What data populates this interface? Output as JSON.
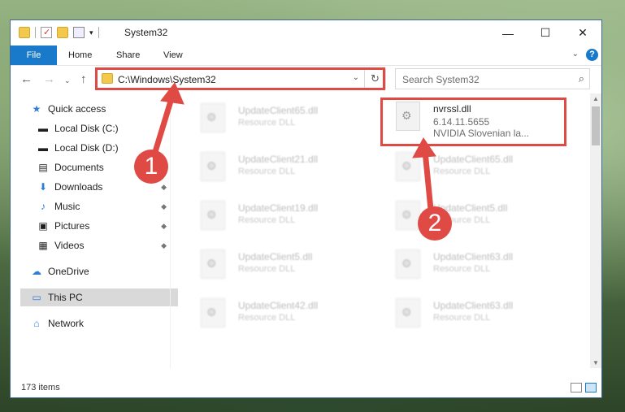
{
  "window": {
    "title": "System32"
  },
  "ribbon": {
    "tabs": [
      "File",
      "Home",
      "Share",
      "View"
    ],
    "help": "?"
  },
  "nav": {
    "address": "C:\\Windows\\System32",
    "search_placeholder": "Search System32"
  },
  "sidebar": {
    "items": [
      {
        "label": "Quick access",
        "icon": "star-icon"
      },
      {
        "label": "Local Disk (C:)",
        "icon": "drive-icon"
      },
      {
        "label": "Local Disk (D:)",
        "icon": "drive-icon"
      },
      {
        "label": "Documents",
        "icon": "documents-icon"
      },
      {
        "label": "Downloads",
        "icon": "download-icon"
      },
      {
        "label": "Music",
        "icon": "music-icon"
      },
      {
        "label": "Pictures",
        "icon": "pictures-icon"
      },
      {
        "label": "Videos",
        "icon": "videos-icon"
      },
      {
        "label": "OneDrive",
        "icon": "cloud-icon"
      },
      {
        "label": "This PC",
        "icon": "computer-icon"
      },
      {
        "label": "Network",
        "icon": "network-icon"
      }
    ]
  },
  "files": [
    {
      "name": "UpdateClient65.dll",
      "type": "Resource DLL"
    },
    {
      "name": "nvrssl.dll",
      "version": "6.14.11.5655",
      "desc": "NVIDIA Slovenian la..."
    },
    {
      "name": "UpdateClient21.dll",
      "type": "Resource DLL"
    },
    {
      "name": "UpdateClient65.dll",
      "type": "Resource DLL"
    },
    {
      "name": "UpdateClient19.dll",
      "type": "Resource DLL"
    },
    {
      "name": "UpdateClient5.dll",
      "type": "Resource DLL"
    },
    {
      "name": "UpdateClient5.dll",
      "type": "Resource DLL"
    },
    {
      "name": "UpdateClient63.dll",
      "type": "Resource DLL"
    },
    {
      "name": "UpdateClient42.dll",
      "type": "Resource DLL"
    },
    {
      "name": "UpdateClient63.dll",
      "type": "Resource DLL"
    }
  ],
  "status": {
    "count": "173 items"
  },
  "annotations": {
    "marker1": "1",
    "marker2": "2"
  },
  "colors": {
    "accent": "#1979ca",
    "annotation": "#e04a45"
  }
}
